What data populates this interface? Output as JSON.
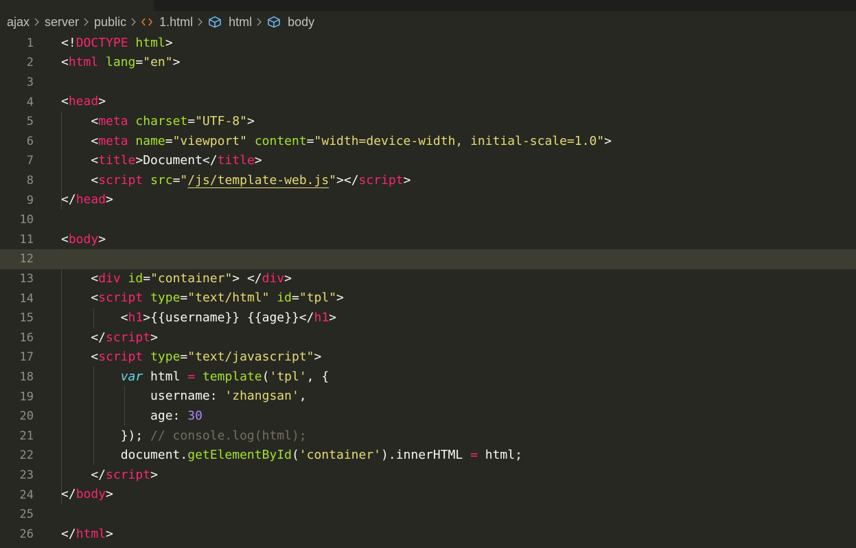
{
  "breadcrumb": {
    "items": [
      "ajax",
      "server",
      "public",
      "1.html",
      "html",
      "body"
    ]
  },
  "colors": {
    "background": "#272822",
    "tag": "#f92672",
    "attribute": "#a6e22e",
    "string": "#e6db74",
    "keyword": "#66d9ef",
    "number": "#ae81ff",
    "comment": "#75715e",
    "text": "#f8f8f2",
    "current_line": "#3e3d32"
  },
  "editor": {
    "current_line": 12,
    "lines": [
      {
        "n": "1",
        "tokens": [
          [
            "pun",
            "<!"
          ],
          [
            "tag",
            "DOCTYPE"
          ],
          [
            "pun",
            " "
          ],
          [
            "attr",
            "html"
          ],
          [
            "pun",
            ">"
          ]
        ]
      },
      {
        "n": "2",
        "tokens": [
          [
            "pun",
            "<"
          ],
          [
            "tag",
            "html"
          ],
          [
            "pun",
            " "
          ],
          [
            "attr",
            "lang"
          ],
          [
            "pun",
            "="
          ],
          [
            "str",
            "\"en\""
          ],
          [
            "pun",
            ">"
          ]
        ]
      },
      {
        "n": "3",
        "tokens": []
      },
      {
        "n": "4",
        "tokens": [
          [
            "pun",
            "<"
          ],
          [
            "tag",
            "head"
          ],
          [
            "pun",
            ">"
          ]
        ]
      },
      {
        "n": "5",
        "tokens": [
          [
            "pun",
            "    <"
          ],
          [
            "tag",
            "meta"
          ],
          [
            "pun",
            " "
          ],
          [
            "attr",
            "charset"
          ],
          [
            "pun",
            "="
          ],
          [
            "str",
            "\"UTF-8\""
          ],
          [
            "pun",
            ">"
          ]
        ]
      },
      {
        "n": "6",
        "tokens": [
          [
            "pun",
            "    <"
          ],
          [
            "tag",
            "meta"
          ],
          [
            "pun",
            " "
          ],
          [
            "attr",
            "name"
          ],
          [
            "pun",
            "="
          ],
          [
            "str",
            "\"viewport\""
          ],
          [
            "pun",
            " "
          ],
          [
            "attr",
            "content"
          ],
          [
            "pun",
            "="
          ],
          [
            "str",
            "\"width=device-width, initial-scale=1.0\""
          ],
          [
            "pun",
            ">"
          ]
        ]
      },
      {
        "n": "7",
        "tokens": [
          [
            "pun",
            "    <"
          ],
          [
            "tag",
            "title"
          ],
          [
            "pun",
            ">Document</"
          ],
          [
            "tag",
            "title"
          ],
          [
            "pun",
            ">"
          ]
        ]
      },
      {
        "n": "8",
        "tokens": [
          [
            "pun",
            "    <"
          ],
          [
            "tag",
            "script"
          ],
          [
            "pun",
            " "
          ],
          [
            "attr",
            "src"
          ],
          [
            "pun",
            "="
          ],
          [
            "str",
            "\""
          ],
          [
            "strlink",
            "/js/template-web.js"
          ],
          [
            "str",
            "\""
          ],
          [
            "pun",
            "></"
          ],
          [
            "tag",
            "script"
          ],
          [
            "pun",
            ">"
          ]
        ]
      },
      {
        "n": "9",
        "tokens": [
          [
            "pun",
            "</"
          ],
          [
            "tag",
            "head"
          ],
          [
            "pun",
            ">"
          ]
        ]
      },
      {
        "n": "10",
        "tokens": []
      },
      {
        "n": "11",
        "tokens": [
          [
            "pun",
            "<"
          ],
          [
            "tag",
            "body"
          ],
          [
            "pun",
            ">"
          ]
        ]
      },
      {
        "n": "12",
        "tokens": []
      },
      {
        "n": "13",
        "tokens": [
          [
            "pun",
            "    <"
          ],
          [
            "tag",
            "div"
          ],
          [
            "pun",
            " "
          ],
          [
            "attr",
            "id"
          ],
          [
            "pun",
            "="
          ],
          [
            "str",
            "\"container\""
          ],
          [
            "pun",
            "> </"
          ],
          [
            "tag",
            "div"
          ],
          [
            "pun",
            ">"
          ]
        ]
      },
      {
        "n": "14",
        "tokens": [
          [
            "pun",
            "    <"
          ],
          [
            "tag",
            "script"
          ],
          [
            "pun",
            " "
          ],
          [
            "attr",
            "type"
          ],
          [
            "pun",
            "="
          ],
          [
            "str",
            "\"text/html\""
          ],
          [
            "pun",
            " "
          ],
          [
            "attr",
            "id"
          ],
          [
            "pun",
            "="
          ],
          [
            "str",
            "\"tpl\""
          ],
          [
            "pun",
            ">"
          ]
        ]
      },
      {
        "n": "15",
        "tokens": [
          [
            "pun",
            "        <"
          ],
          [
            "tag",
            "h1"
          ],
          [
            "pun",
            ">{{username}} {{age}}</"
          ],
          [
            "tag",
            "h1"
          ],
          [
            "pun",
            ">"
          ]
        ]
      },
      {
        "n": "16",
        "tokens": [
          [
            "pun",
            "    </"
          ],
          [
            "tag",
            "script"
          ],
          [
            "pun",
            ">"
          ]
        ]
      },
      {
        "n": "17",
        "tokens": [
          [
            "pun",
            "    <"
          ],
          [
            "tag",
            "script"
          ],
          [
            "pun",
            " "
          ],
          [
            "attr",
            "type"
          ],
          [
            "pun",
            "="
          ],
          [
            "str",
            "\"text/javascript\""
          ],
          [
            "pun",
            ">"
          ]
        ]
      },
      {
        "n": "18",
        "tokens": [
          [
            "pun",
            "        "
          ],
          [
            "kw",
            "var"
          ],
          [
            "pun",
            " html "
          ],
          [
            "op",
            "="
          ],
          [
            "pun",
            " "
          ],
          [
            "fn",
            "template"
          ],
          [
            "pun",
            "("
          ],
          [
            "str",
            "'tpl'"
          ],
          [
            "pun",
            ", {"
          ]
        ]
      },
      {
        "n": "19",
        "tokens": [
          [
            "pun",
            "            username: "
          ],
          [
            "str",
            "'zhangsan'"
          ],
          [
            "pun",
            ","
          ]
        ]
      },
      {
        "n": "20",
        "tokens": [
          [
            "pun",
            "            age: "
          ],
          [
            "num",
            "30"
          ]
        ]
      },
      {
        "n": "21",
        "tokens": [
          [
            "pun",
            "        }); "
          ],
          [
            "com",
            "// console.log(html);"
          ]
        ]
      },
      {
        "n": "22",
        "tokens": [
          [
            "pun",
            "        document."
          ],
          [
            "fn",
            "getElementById"
          ],
          [
            "pun",
            "("
          ],
          [
            "str",
            "'container'"
          ],
          [
            "pun",
            ").innerHTML "
          ],
          [
            "op",
            "="
          ],
          [
            "pun",
            " html;"
          ]
        ]
      },
      {
        "n": "23",
        "tokens": [
          [
            "pun",
            "    </"
          ],
          [
            "tag",
            "script"
          ],
          [
            "pun",
            ">"
          ]
        ]
      },
      {
        "n": "24",
        "tokens": [
          [
            "pun",
            "</"
          ],
          [
            "tag",
            "body"
          ],
          [
            "pun",
            ">"
          ]
        ]
      },
      {
        "n": "25",
        "tokens": []
      },
      {
        "n": "26",
        "tokens": [
          [
            "pun",
            "</"
          ],
          [
            "tag",
            "html"
          ],
          [
            "pun",
            ">"
          ]
        ]
      }
    ]
  }
}
